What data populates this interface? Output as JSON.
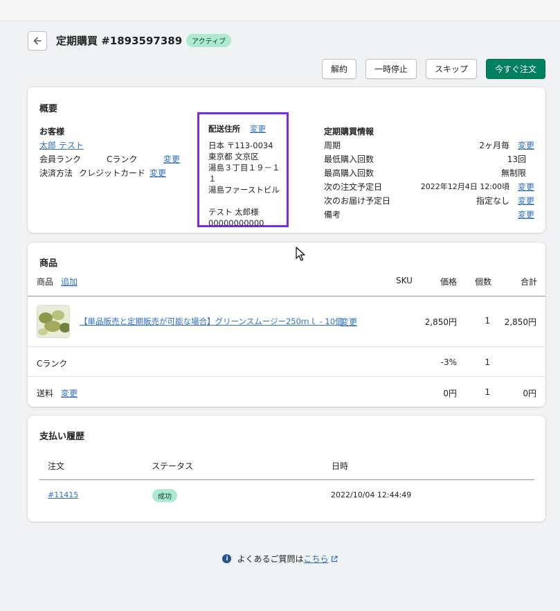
{
  "header": {
    "title": "定期購買 #1893597389",
    "status_badge": "アクティブ"
  },
  "actions": {
    "cancel": "解約",
    "pause": "一時停止",
    "skip": "スキップ",
    "order_now": "今すぐ注文"
  },
  "overview": {
    "title": "概要",
    "customer": {
      "heading": "お客様",
      "name": "太郎 テスト",
      "rank_label": "会員ランク",
      "rank_value": "Cランク",
      "rank_change": "変更",
      "payment_label": "決済方法",
      "payment_value": "クレジットカード",
      "payment_change": "変更"
    },
    "shipping": {
      "heading": "配送住所",
      "change": "変更",
      "line1": "日本 〒113-0034",
      "line2": "東京都 文京区",
      "line3": "湯島３丁目１９－１１",
      "line4": "湯島ファーストビル",
      "recipient": "テスト 太郎様",
      "phone": "00000000000"
    },
    "subscription": {
      "heading": "定期購買情報",
      "rows": [
        {
          "label": "周期",
          "value": "2ヶ月毎",
          "change": "変更"
        },
        {
          "label": "最低購入回数",
          "value": "13回",
          "change": ""
        },
        {
          "label": "最高購入回数",
          "value": "無制限",
          "change": ""
        },
        {
          "label": "次の注文予定日",
          "value": "2022年12月4日 12:00頃",
          "change": "変更"
        },
        {
          "label": "次のお届け予定日",
          "value": "指定なし",
          "change": "変更"
        },
        {
          "label": "備考",
          "value": "",
          "change": "変更"
        }
      ]
    }
  },
  "products": {
    "title": "商品",
    "headers": {
      "product": "商品",
      "add": "追加",
      "sku": "SKU",
      "price": "価格",
      "qty": "個数",
      "total": "合計"
    },
    "item": {
      "name": "【単品販売と定期販売が可能な場合】グリーンスムージー250ｍｌ - 10個",
      "change": "変更",
      "price": "2,850円",
      "qty": "1",
      "total": "2,850円"
    },
    "rank_row": {
      "label": "Cランク",
      "price": "-3%",
      "qty": "1"
    },
    "shipping_row": {
      "label": "送料",
      "change": "変更",
      "price": "0円",
      "qty": "1",
      "total": "0円"
    }
  },
  "payments": {
    "title": "支払い履歴",
    "headers": {
      "order": "注文",
      "status": "ステータス",
      "date": "日時"
    },
    "rows": [
      {
        "order": "#11415",
        "status": "成功",
        "date": "2022/10/04 12:44:49"
      }
    ]
  },
  "footer": {
    "text": "よくあるご質問は",
    "link": "こちら"
  }
}
